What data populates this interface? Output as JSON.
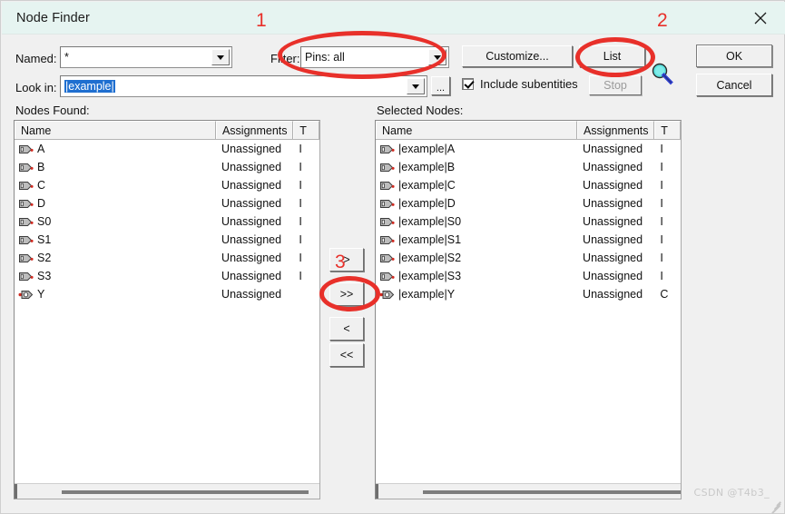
{
  "window": {
    "title": "Node Finder",
    "close_icon": "close-icon"
  },
  "annotations": [
    {
      "label": "1",
      "target": "filter-combo"
    },
    {
      "label": "2",
      "target": "list-button"
    },
    {
      "label": "3",
      "target": "move-all-right-button"
    }
  ],
  "form": {
    "named_label": "Named:",
    "named_value": "*",
    "named_placeholder": "*",
    "filter_label": "Filter:",
    "filter_value": "Pins: all",
    "lookin_label": "Look in:",
    "lookin_value": "|example|",
    "lookin_placeholder": "|example|",
    "browse_button": "...",
    "include_subentities_label": "Include subentities",
    "include_subentities_checked": true
  },
  "toolbar": {
    "customize_label": "Customize...",
    "list_label": "List",
    "stop_label": "Stop",
    "stop_disabled": true,
    "ok_label": "OK",
    "cancel_label": "Cancel",
    "search_icon": "magnifier-icon"
  },
  "transfer_buttons": [
    {
      "name": "move-right-button",
      "label": ">"
    },
    {
      "name": "move-all-right-button",
      "label": ">>"
    },
    {
      "name": "move-left-button",
      "label": "<"
    },
    {
      "name": "move-all-left-button",
      "label": "<<"
    }
  ],
  "nodes_found": {
    "title": "Nodes Found:",
    "columns": [
      "Name",
      "Assignments",
      "T"
    ],
    "rows": [
      {
        "icon": "input-pin-icon",
        "name": "A",
        "assignment": "Unassigned",
        "type": "I"
      },
      {
        "icon": "input-pin-icon",
        "name": "B",
        "assignment": "Unassigned",
        "type": "I"
      },
      {
        "icon": "input-pin-icon",
        "name": "C",
        "assignment": "Unassigned",
        "type": "I"
      },
      {
        "icon": "input-pin-icon",
        "name": "D",
        "assignment": "Unassigned",
        "type": "I"
      },
      {
        "icon": "input-pin-icon",
        "name": "S0",
        "assignment": "Unassigned",
        "type": "I"
      },
      {
        "icon": "input-pin-icon",
        "name": "S1",
        "assignment": "Unassigned",
        "type": "I"
      },
      {
        "icon": "input-pin-icon",
        "name": "S2",
        "assignment": "Unassigned",
        "type": "I"
      },
      {
        "icon": "input-pin-icon",
        "name": "S3",
        "assignment": "Unassigned",
        "type": "I"
      },
      {
        "icon": "output-pin-icon",
        "name": "Y",
        "assignment": "Unassigned",
        "type": ""
      }
    ]
  },
  "selected_nodes": {
    "title": "Selected Nodes:",
    "columns": [
      "Name",
      "Assignments",
      "T"
    ],
    "rows": [
      {
        "icon": "input-pin-icon",
        "name": "|example|A",
        "assignment": "Unassigned",
        "type": "I"
      },
      {
        "icon": "input-pin-icon",
        "name": "|example|B",
        "assignment": "Unassigned",
        "type": "I"
      },
      {
        "icon": "input-pin-icon",
        "name": "|example|C",
        "assignment": "Unassigned",
        "type": "I"
      },
      {
        "icon": "input-pin-icon",
        "name": "|example|D",
        "assignment": "Unassigned",
        "type": "I"
      },
      {
        "icon": "input-pin-icon",
        "name": "|example|S0",
        "assignment": "Unassigned",
        "type": "I"
      },
      {
        "icon": "input-pin-icon",
        "name": "|example|S1",
        "assignment": "Unassigned",
        "type": "I"
      },
      {
        "icon": "input-pin-icon",
        "name": "|example|S2",
        "assignment": "Unassigned",
        "type": "I"
      },
      {
        "icon": "input-pin-icon",
        "name": "|example|S3",
        "assignment": "Unassigned",
        "type": "I"
      },
      {
        "icon": "output-pin-icon",
        "name": "|example|Y",
        "assignment": "Unassigned",
        "type": "C"
      }
    ]
  },
  "watermark": "CSDN @T4b3_",
  "colors": {
    "titlebar": "#e6f4f1",
    "dialog": "#f0f0f0",
    "annotation": "#e8302a",
    "selection": "#1f6fd0"
  }
}
